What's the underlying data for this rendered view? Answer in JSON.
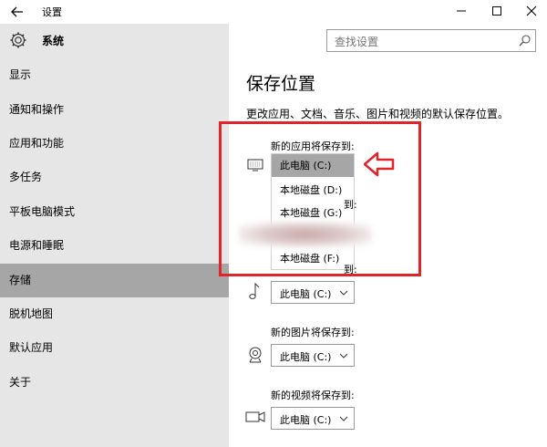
{
  "window": {
    "title": "设置"
  },
  "sidebar": {
    "header": "系统",
    "items": [
      {
        "label": "显示"
      },
      {
        "label": "通知和操作"
      },
      {
        "label": "应用和功能"
      },
      {
        "label": "多任务"
      },
      {
        "label": "平板电脑模式"
      },
      {
        "label": "电源和睡眠"
      },
      {
        "label": "存储",
        "selected": true
      },
      {
        "label": "脱机地图"
      },
      {
        "label": "默认应用"
      },
      {
        "label": "关于"
      }
    ]
  },
  "search": {
    "placeholder": "查找设置"
  },
  "main": {
    "title": "保存位置",
    "description": "更改应用、文档、音乐、图片和视频的默认保存位置。",
    "apps_label": "新的应用将保存到:",
    "apps_selected": "此电脑 (C:)",
    "dropdown_options": [
      "此电脑 (C:)",
      "本地磁盘 (D:)",
      "本地磁盘 (G:)",
      "本地磁盘 (F:)"
    ],
    "label_fragment_1": "到:",
    "label_fragment_2": "到:",
    "music_value": "此电脑 (C:)",
    "pictures_label": "新的图片将保存到:",
    "pictures_value": "此电脑 (C:)",
    "videos_label": "新的视频将保存到:",
    "videos_value": "此电脑 (C:)"
  },
  "colors": {
    "highlight": "#e0252a",
    "selected_bg": "#a6a6a6",
    "sidebar_bg": "#e6e6e6"
  }
}
